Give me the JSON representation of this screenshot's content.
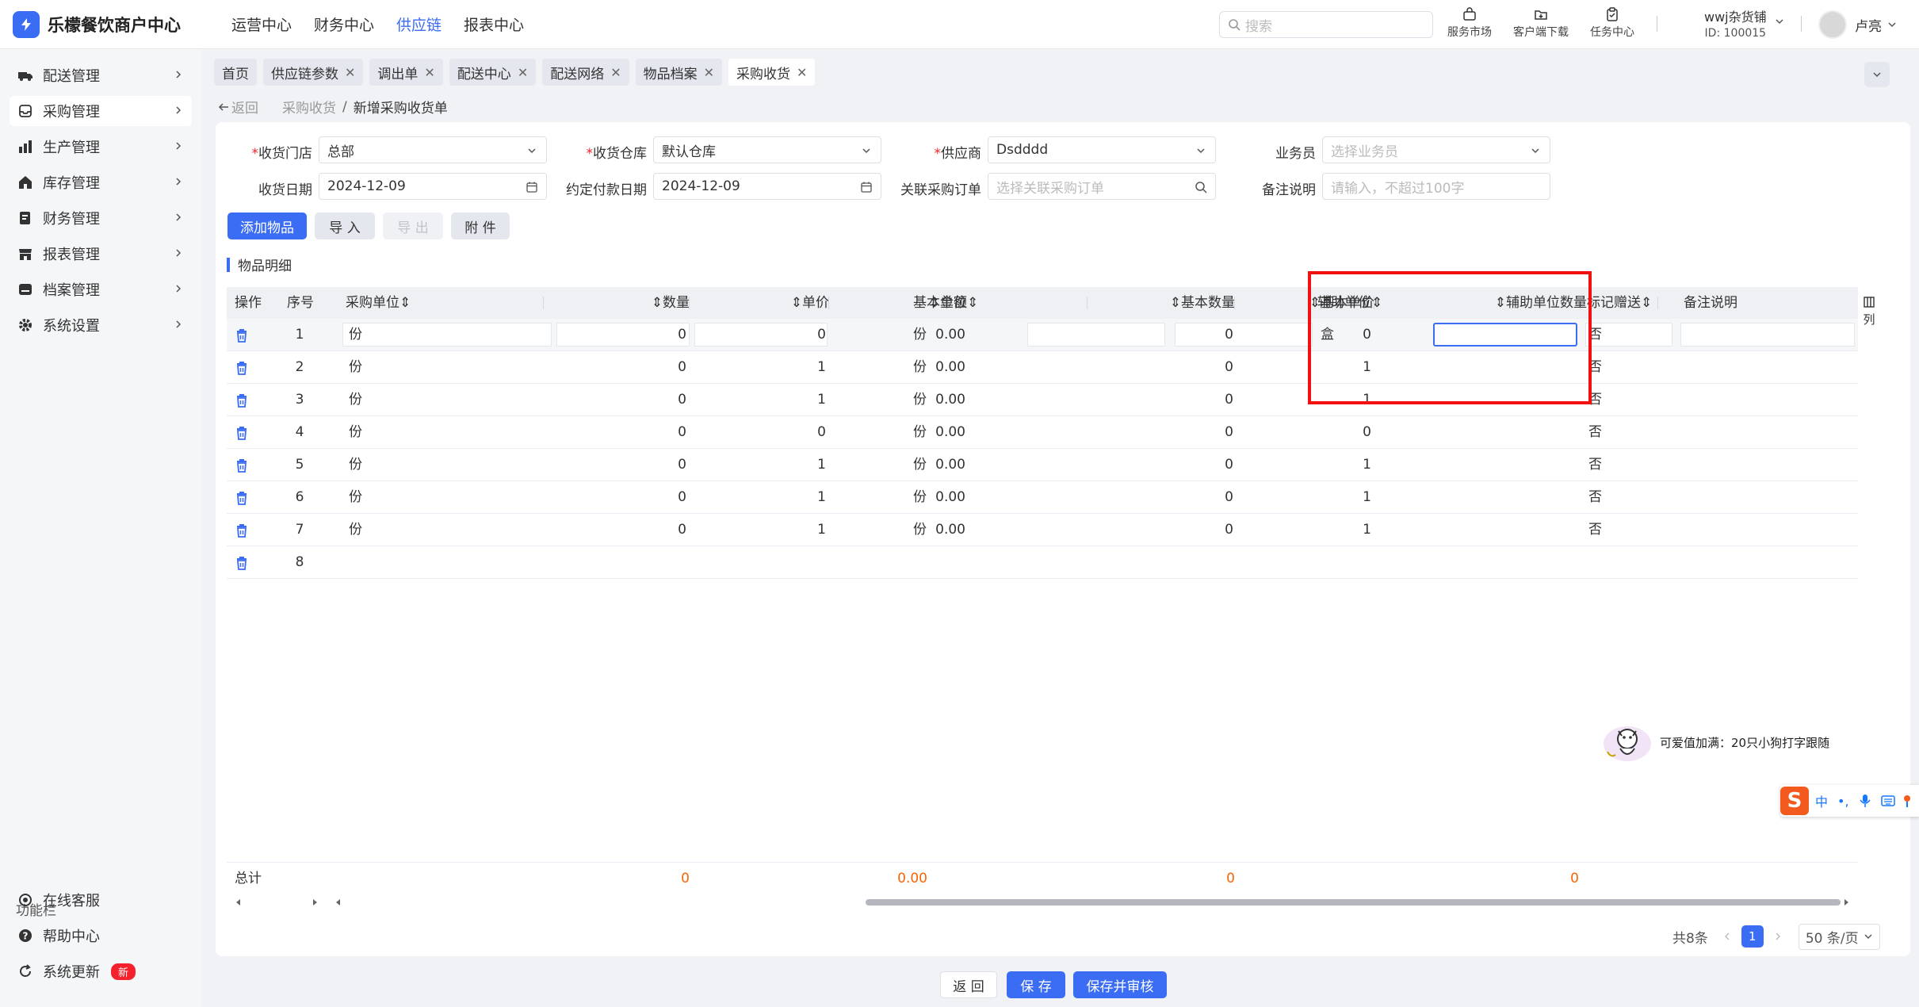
{
  "app": {
    "name": "乐檬餐饮商户中心",
    "top_nav": [
      "运营中心",
      "财务中心",
      "供应链",
      "报表中心"
    ],
    "search_placeholder": "搜索",
    "tools": [
      "服务市场",
      "客户端下载",
      "任务中心"
    ],
    "account": {
      "shop": "wwj杂货铺",
      "id": "ID: 100015"
    },
    "user_name": "卢亮"
  },
  "sidebar": {
    "items": [
      "配送管理",
      "采购管理",
      "生产管理",
      "库存管理",
      "财务管理",
      "报表管理",
      "档案管理",
      "系统设置"
    ],
    "func_label": "功能栏",
    "func_items": [
      "在线客服",
      "帮助中心",
      "系统更新"
    ],
    "new_badge": "新"
  },
  "tabs": [
    "首页",
    "供应链参数",
    "调出单",
    "配送中心",
    "配送网络",
    "物品档案",
    "采购收货"
  ],
  "breadcrumb": {
    "back": "返回",
    "parent": "采购收货",
    "sep": "/",
    "current": "新增采购收货单"
  },
  "form": {
    "store_label": "收货门店",
    "store_value": "总部",
    "warehouse_label": "收货仓库",
    "warehouse_value": "默认仓库",
    "supplier_label": "供应商",
    "supplier_value": "Dsdddd",
    "salesman_label": "业务员",
    "salesman_placeholder": "选择业务员",
    "date_label": "收货日期",
    "date_value": "2024-12-09",
    "pay_date_label": "约定付款日期",
    "pay_date_value": "2024-12-09",
    "order_label": "关联采购订单",
    "order_placeholder": "选择关联采购订单",
    "remark_label": "备注说明",
    "remark_placeholder": "请输入，不超过100字"
  },
  "actions": {
    "add": "添加物品",
    "import": "导 入",
    "export": "导 出",
    "attach": "附 件"
  },
  "section_title": "物品明细",
  "table": {
    "headers": [
      "操作",
      "序号",
      "采购单位",
      "数量",
      "单价",
      "金额",
      "基本单位",
      "基本数量",
      "基本单价",
      "辅助单位",
      "辅助单位数量",
      "标记赠送",
      "备注说明"
    ],
    "rows": [
      {
        "no": "1",
        "unit": "份",
        "qty": "0",
        "price": "0",
        "amount": "0.00",
        "base_unit": "份",
        "base_qty": "0",
        "base_price": "0",
        "aux_unit": "盒",
        "aux_qty": "",
        "gift": "否"
      },
      {
        "no": "2",
        "unit": "份",
        "qty": "0",
        "price": "1",
        "amount": "0.00",
        "base_unit": "份",
        "base_qty": "0",
        "base_price": "1",
        "aux_unit": "",
        "aux_qty": "",
        "gift": "否"
      },
      {
        "no": "3",
        "unit": "份",
        "qty": "0",
        "price": "1",
        "amount": "0.00",
        "base_unit": "份",
        "base_qty": "0",
        "base_price": "1",
        "aux_unit": "",
        "aux_qty": "",
        "gift": "否"
      },
      {
        "no": "4",
        "unit": "份",
        "qty": "0",
        "price": "0",
        "amount": "0.00",
        "base_unit": "份",
        "base_qty": "0",
        "base_price": "0",
        "aux_unit": "",
        "aux_qty": "",
        "gift": "否"
      },
      {
        "no": "5",
        "unit": "份",
        "qty": "0",
        "price": "1",
        "amount": "0.00",
        "base_unit": "份",
        "base_qty": "0",
        "base_price": "1",
        "aux_unit": "",
        "aux_qty": "",
        "gift": "否"
      },
      {
        "no": "6",
        "unit": "份",
        "qty": "0",
        "price": "1",
        "amount": "0.00",
        "base_unit": "份",
        "base_qty": "0",
        "base_price": "1",
        "aux_unit": "",
        "aux_qty": "",
        "gift": "否"
      },
      {
        "no": "7",
        "unit": "份",
        "qty": "0",
        "price": "1",
        "amount": "0.00",
        "base_unit": "份",
        "base_qty": "0",
        "base_price": "1",
        "aux_unit": "",
        "aux_qty": "",
        "gift": "否"
      },
      {
        "no": "8",
        "unit": "",
        "qty": "",
        "price": "",
        "amount": "",
        "base_unit": "",
        "base_qty": "",
        "base_price": "",
        "aux_unit": "",
        "aux_qty": "",
        "gift": ""
      }
    ],
    "total": {
      "label": "总计",
      "qty": "0",
      "amount": "0.00",
      "base_qty": "0",
      "aux_qty": "0"
    },
    "col_toggle": "列"
  },
  "pager": {
    "total": "共8条",
    "page": "1",
    "size": "50 条/页"
  },
  "footer": {
    "back": "返 回",
    "save": "保 存",
    "save_audit": "保存并审核"
  },
  "promo_text": "可爱值加满：20只小狗打字跟随",
  "ime": [
    "中",
    "•,"
  ],
  "colors": {
    "primary": "#3a6cf4",
    "highlight": "#f21010",
    "total": "#fa6400"
  }
}
